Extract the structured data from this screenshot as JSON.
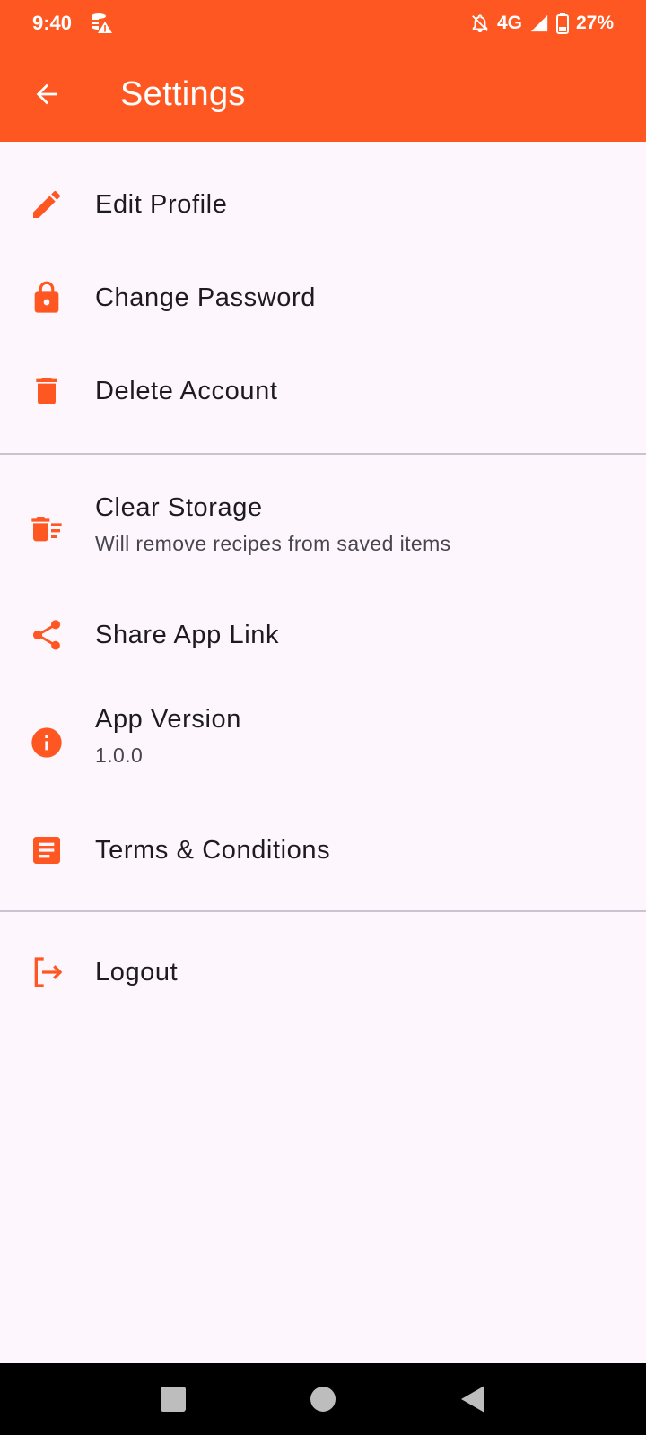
{
  "status_bar": {
    "time": "9:40",
    "network": "4G",
    "battery": "27%",
    "icons": [
      "database-warning-icon",
      "bell-off-icon",
      "signal-icon",
      "battery-icon"
    ]
  },
  "app_bar": {
    "title": "Settings",
    "back_icon": "arrow-back-icon"
  },
  "colors": {
    "accent": "#ff5722",
    "background": "#fdf7fd",
    "text_primary": "#1d1b20",
    "text_secondary": "#49454f",
    "divider": "#cac4d0"
  },
  "sections": [
    {
      "items": [
        {
          "label": "Edit Profile",
          "icon": "pencil-icon"
        },
        {
          "label": "Change Password",
          "icon": "lock-icon"
        },
        {
          "label": "Delete Account",
          "icon": "trash-icon"
        }
      ]
    },
    {
      "items": [
        {
          "label": "Clear Storage",
          "subtitle": "Will remove recipes from saved items",
          "icon": "delete-sweep-icon"
        },
        {
          "label": "Share App Link",
          "icon": "share-icon"
        },
        {
          "label": "App Version",
          "subtitle": "1.0.0",
          "icon": "info-icon"
        },
        {
          "label": "Terms & Conditions",
          "icon": "document-icon"
        }
      ]
    },
    {
      "items": [
        {
          "label": "Logout",
          "icon": "logout-icon"
        }
      ]
    }
  ],
  "nav_bar": {
    "buttons": [
      "recents-square-icon",
      "home-circle-icon",
      "back-triangle-icon"
    ]
  }
}
